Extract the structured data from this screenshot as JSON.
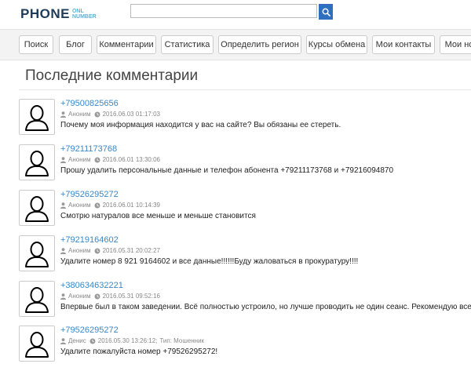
{
  "logo": {
    "main": "PHONE",
    "sub_top": "ONL",
    "sub_bottom": "NUMBER"
  },
  "search": {
    "placeholder": "",
    "value": ""
  },
  "nav": [
    "Поиск",
    "Блог",
    "Комментарии",
    "Статистика",
    "Определить регион",
    "Курсы обмена",
    "Мои контакты",
    "Мои но"
  ],
  "page_title": "Последние комментарии",
  "comments": [
    {
      "phone": "+79500825656",
      "author": "Аноним",
      "date": "2016.06.03 01:17:03",
      "extra": "",
      "text": "Почему моя информация находится у вас на сайте? Вы обязаны ее стереть."
    },
    {
      "phone": "+79211173768",
      "author": "Аноним",
      "date": "2016.06.01 13:30:06",
      "extra": "",
      "text": "Прошу удалить персональные данные и телефон абонента +79211173768 и +79216094870"
    },
    {
      "phone": "+79526295272",
      "author": "Аноним",
      "date": "2016.06.01 10:14:39",
      "extra": "",
      "text": "Смотрю натуралов все меньше и меньше становится"
    },
    {
      "phone": "+79219164602",
      "author": "Аноним",
      "date": "2016.05.31 20:02:27",
      "extra": "",
      "text": "Удалите номер 8 921 9164602 и все данные!!!!!!Буду жаловаться в прокуратуру!!!!"
    },
    {
      "phone": "+380634632221",
      "author": "Аноним",
      "date": "2016.05.31 09:52:16",
      "extra": "",
      "text": "Впервые был в таком заведении. Всё полностью устроило, но лучше проводить не один сеанс. Рекомендую всем!"
    },
    {
      "phone": "+79526295272",
      "author": "Денис",
      "date": "2016.05.30 13:26:12;",
      "extra": "Тип: Мошенник",
      "text": "Удалите пожалуйста номер +79526295272!"
    }
  ]
}
